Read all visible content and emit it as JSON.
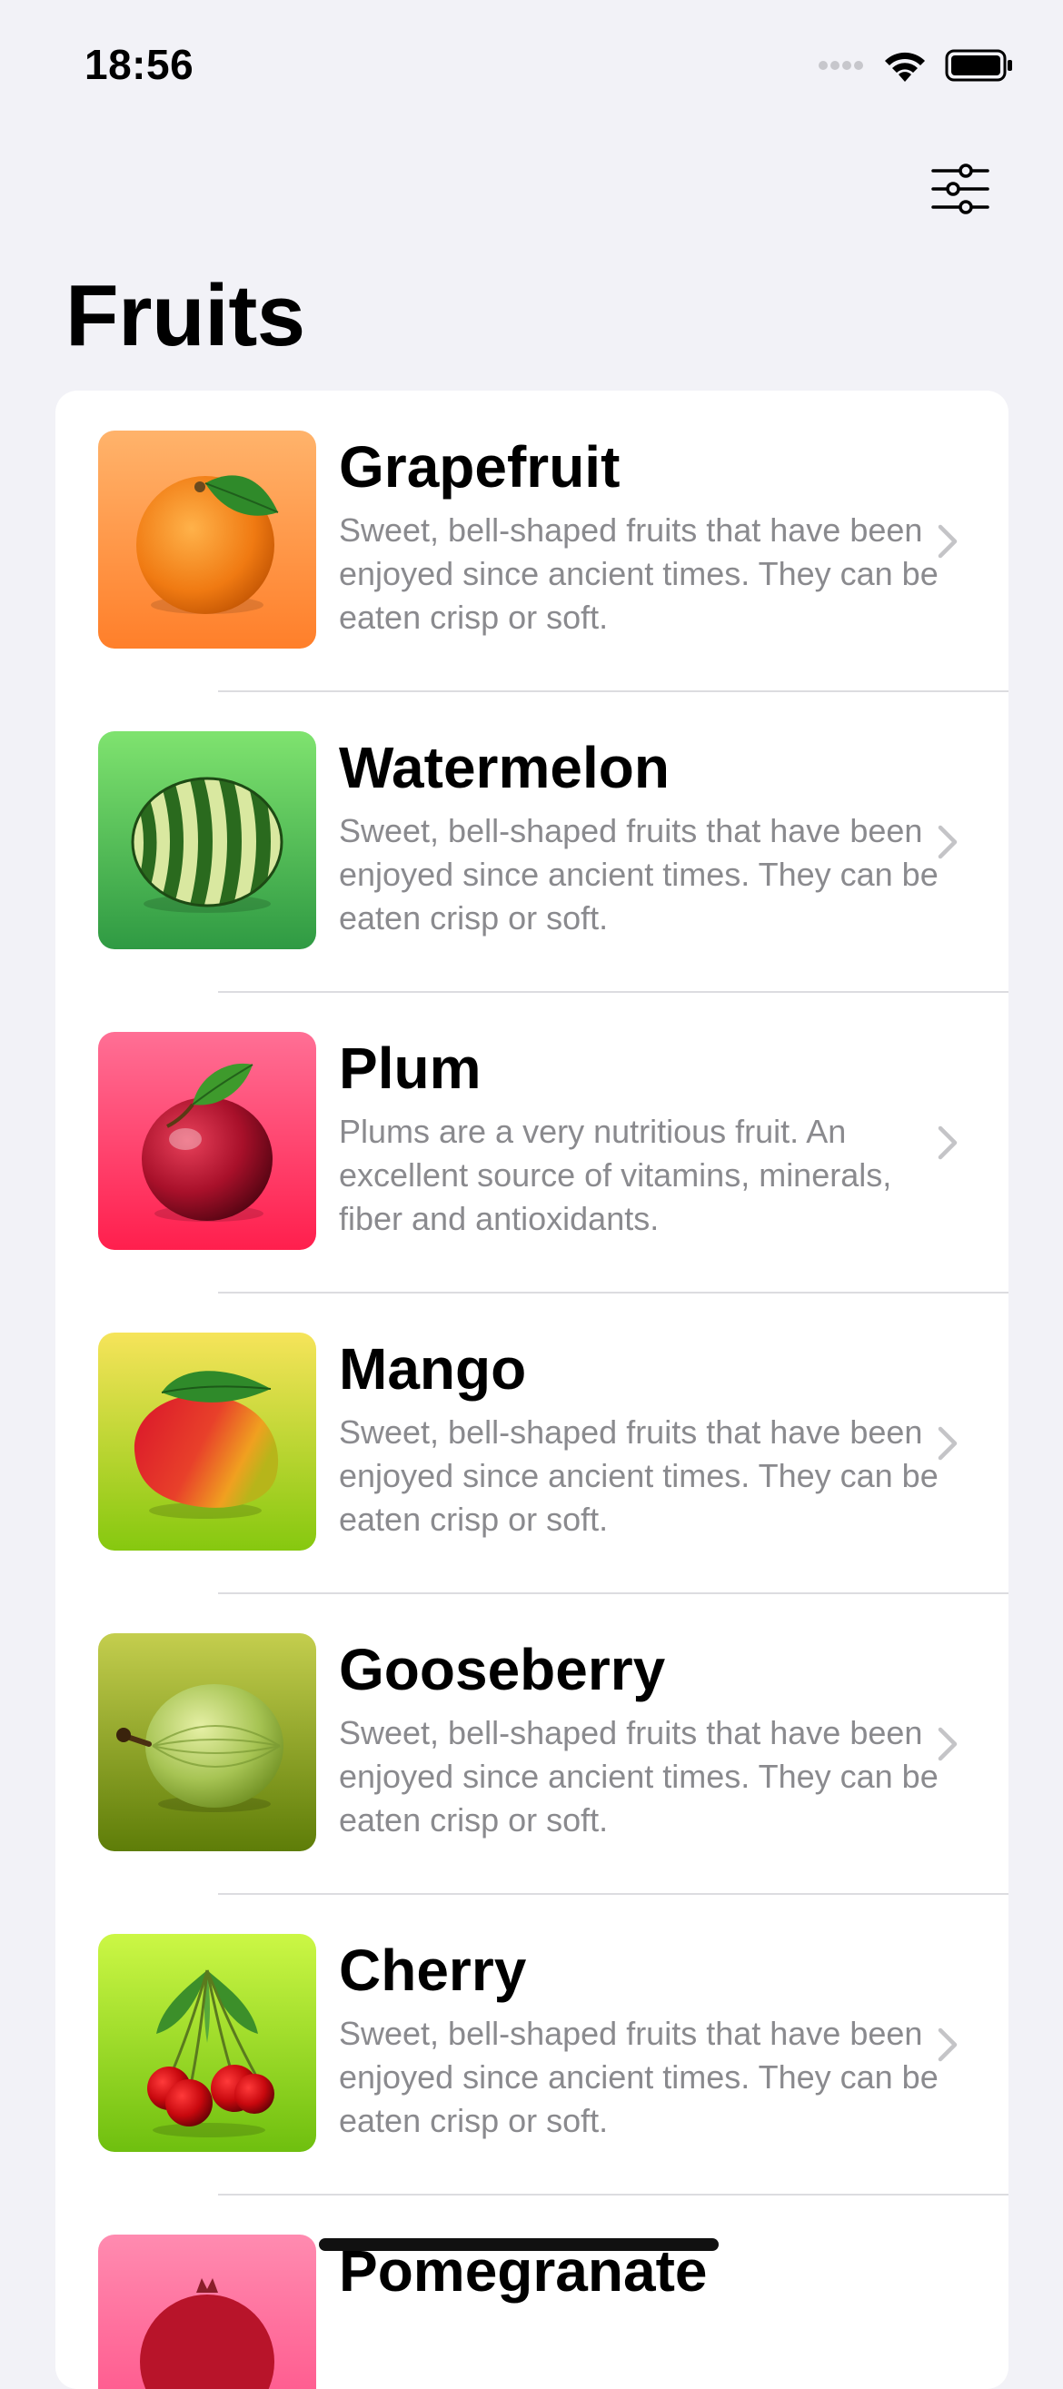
{
  "status_bar": {
    "time": "18:56"
  },
  "header": {
    "title": "Fruits",
    "filter_icon": "sliders-icon"
  },
  "fruits": [
    {
      "name": "Grapefruit",
      "description": "Sweet, bell-shaped fruits that have been enjoyed since ancient times. They can be eaten crisp or soft.",
      "icon": "orange-fruit-icon",
      "gradient": [
        "#ffb36b",
        "#ff7f2a"
      ]
    },
    {
      "name": "Watermelon",
      "description": "Sweet, bell-shaped fruits that have been enjoyed since ancient times. They can be eaten crisp or soft.",
      "icon": "watermelon-icon",
      "gradient": [
        "#7fe36f",
        "#2f9a43"
      ]
    },
    {
      "name": "Plum",
      "description": "Plums are a very nutritious fruit. An excellent source of vitamins, minerals, fiber and antioxidants.",
      "icon": "plum-icon",
      "gradient": [
        "#ff6f95",
        "#ff1f4d"
      ]
    },
    {
      "name": "Mango",
      "description": "Sweet, bell-shaped fruits that have been enjoyed since ancient times. They can be eaten crisp or soft.",
      "icon": "mango-icon",
      "gradient": [
        "#f6e45a",
        "#86c80f"
      ]
    },
    {
      "name": "Gooseberry",
      "description": "Sweet, bell-shaped fruits that have been enjoyed since ancient times. They can be eaten crisp or soft.",
      "icon": "gooseberry-icon",
      "gradient": [
        "#c4ce4e",
        "#5e7d08"
      ]
    },
    {
      "name": "Cherry",
      "description": "Sweet, bell-shaped fruits that have been enjoyed since ancient times. They can be eaten crisp or soft.",
      "icon": "cherry-icon",
      "gradient": [
        "#ccf745",
        "#6fbf0f"
      ]
    },
    {
      "name": "Pomegranate",
      "description": "",
      "icon": "pomegranate-icon",
      "gradient": [
        "#ff8bb0",
        "#ff4c84"
      ]
    }
  ],
  "colors": {
    "background": "#f2f2f7",
    "card": "#ffffff",
    "secondary_text": "#8a8a8e",
    "chevron": "#c4c4c7"
  }
}
